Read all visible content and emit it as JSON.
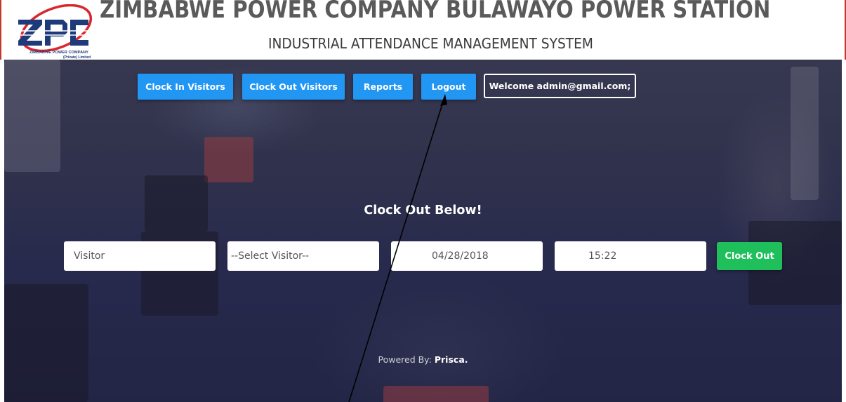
{
  "header": {
    "title": "ZIMBABWE POWER COMPANY BULAWAYO POWER STATION",
    "subtitle": "INDUSTRIAL ATTENDANCE MANAGEMENT SYSTEM",
    "logo": {
      "letters": "ZPC",
      "caption_line1": "ZIMBABWE POWER COMPANY",
      "caption_line2": "(Private) Limited",
      "colors": {
        "blue": "#1f3a7a",
        "red": "#d9262c"
      }
    }
  },
  "nav": {
    "clock_in": "Clock In Visitors",
    "clock_out": "Clock Out Visitors",
    "reports": "Reports",
    "logout": "Logout",
    "welcome": "Welcome admin@gmail.com;"
  },
  "form": {
    "heading": "Clock Out Below!",
    "visitor_value": "Visitor",
    "select_visitor": "--Select Visitor--",
    "date_value": "04/28/2018",
    "time_value": "15:22",
    "submit": "Clock Out"
  },
  "footer": {
    "prefix": "Powered By: ",
    "name": "Prisca."
  },
  "colors": {
    "nav_button": "#2196f3",
    "clock_out_button": "#1fbf5c",
    "header_border": "#c0392b"
  }
}
